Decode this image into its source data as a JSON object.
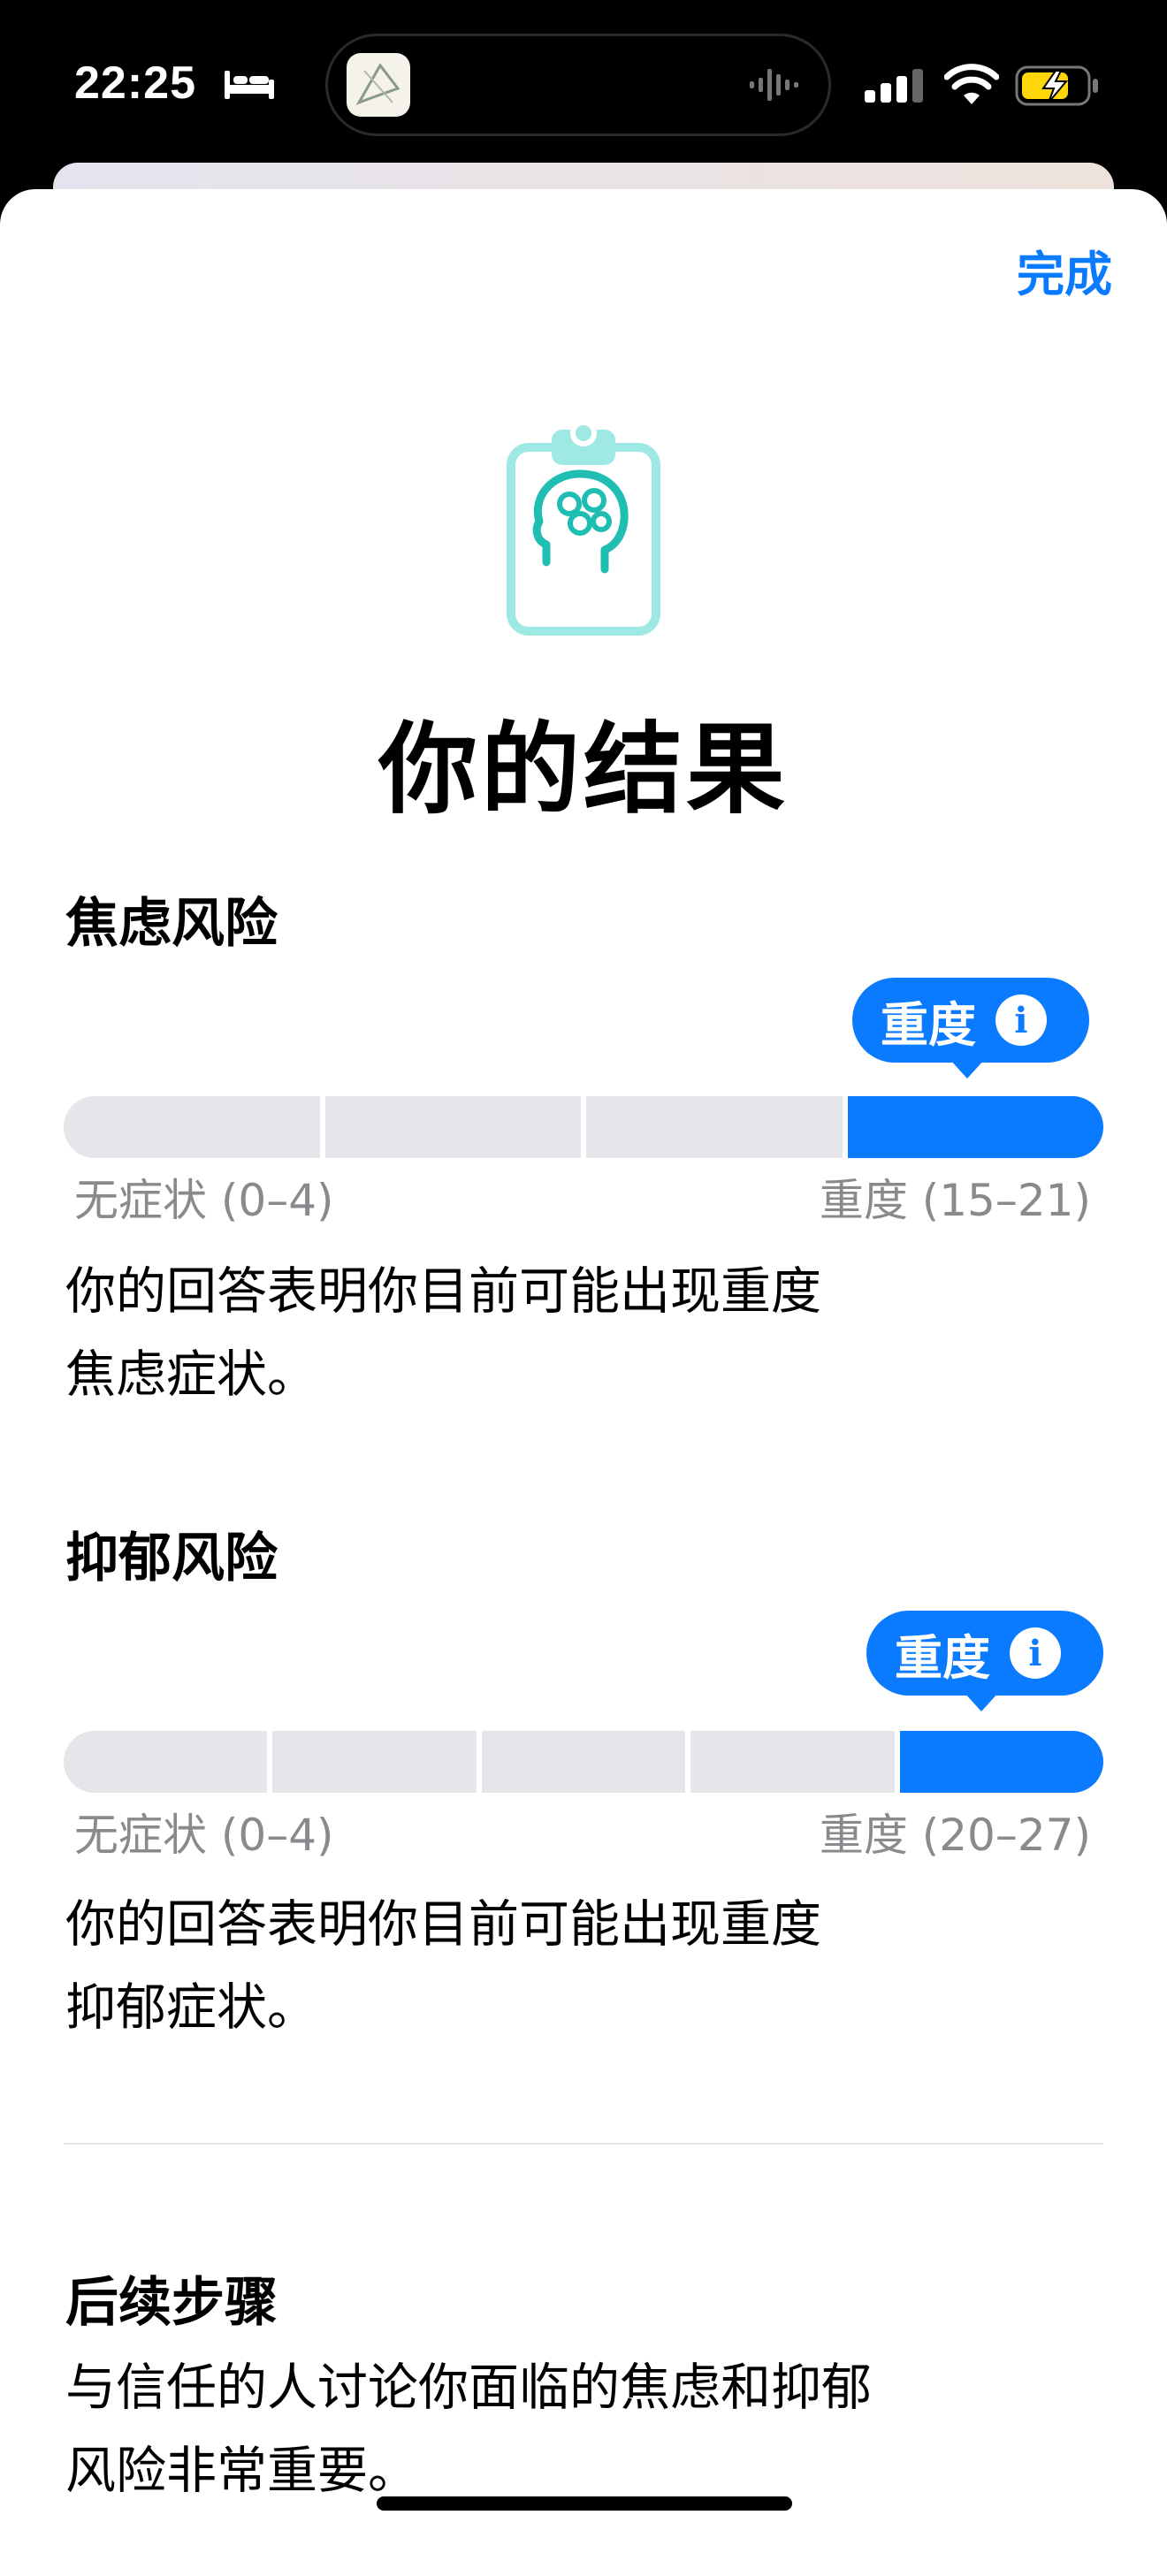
{
  "status_bar": {
    "time": "22:25",
    "icons": [
      "bed-icon",
      "app-thumbnail",
      "audio-wave-icon",
      "cellular-signal-icon",
      "wifi-icon",
      "battery-charging-icon"
    ]
  },
  "header": {
    "done_label": "完成"
  },
  "title": "你的结果",
  "colors": {
    "accent": "#0a7aff",
    "inactive_segment": "#e5e5ea",
    "icon_teal": "#1fbdb2"
  },
  "anxiety": {
    "heading": "焦虑风险",
    "badge": "重度",
    "segment_count": 4,
    "active_segment": 4,
    "min_label": "无症状 (0–4)",
    "max_label": "重度 (15–21)",
    "description_line1": "你的回答表明你目前可能出现重度",
    "description_line2": "焦虑症状。"
  },
  "depression": {
    "heading": "抑郁风险",
    "badge": "重度",
    "segment_count": 5,
    "active_segment": 5,
    "min_label": "无症状 (0–4)",
    "max_label": "重度 (20–27)",
    "description_line1": "你的回答表明你目前可能出现重度",
    "description_line2": "抑郁症状。"
  },
  "next_steps": {
    "heading": "后续步骤",
    "line1": "与信任的人讨论你面临的焦虑和抑郁",
    "line2": "风险非常重要。"
  }
}
